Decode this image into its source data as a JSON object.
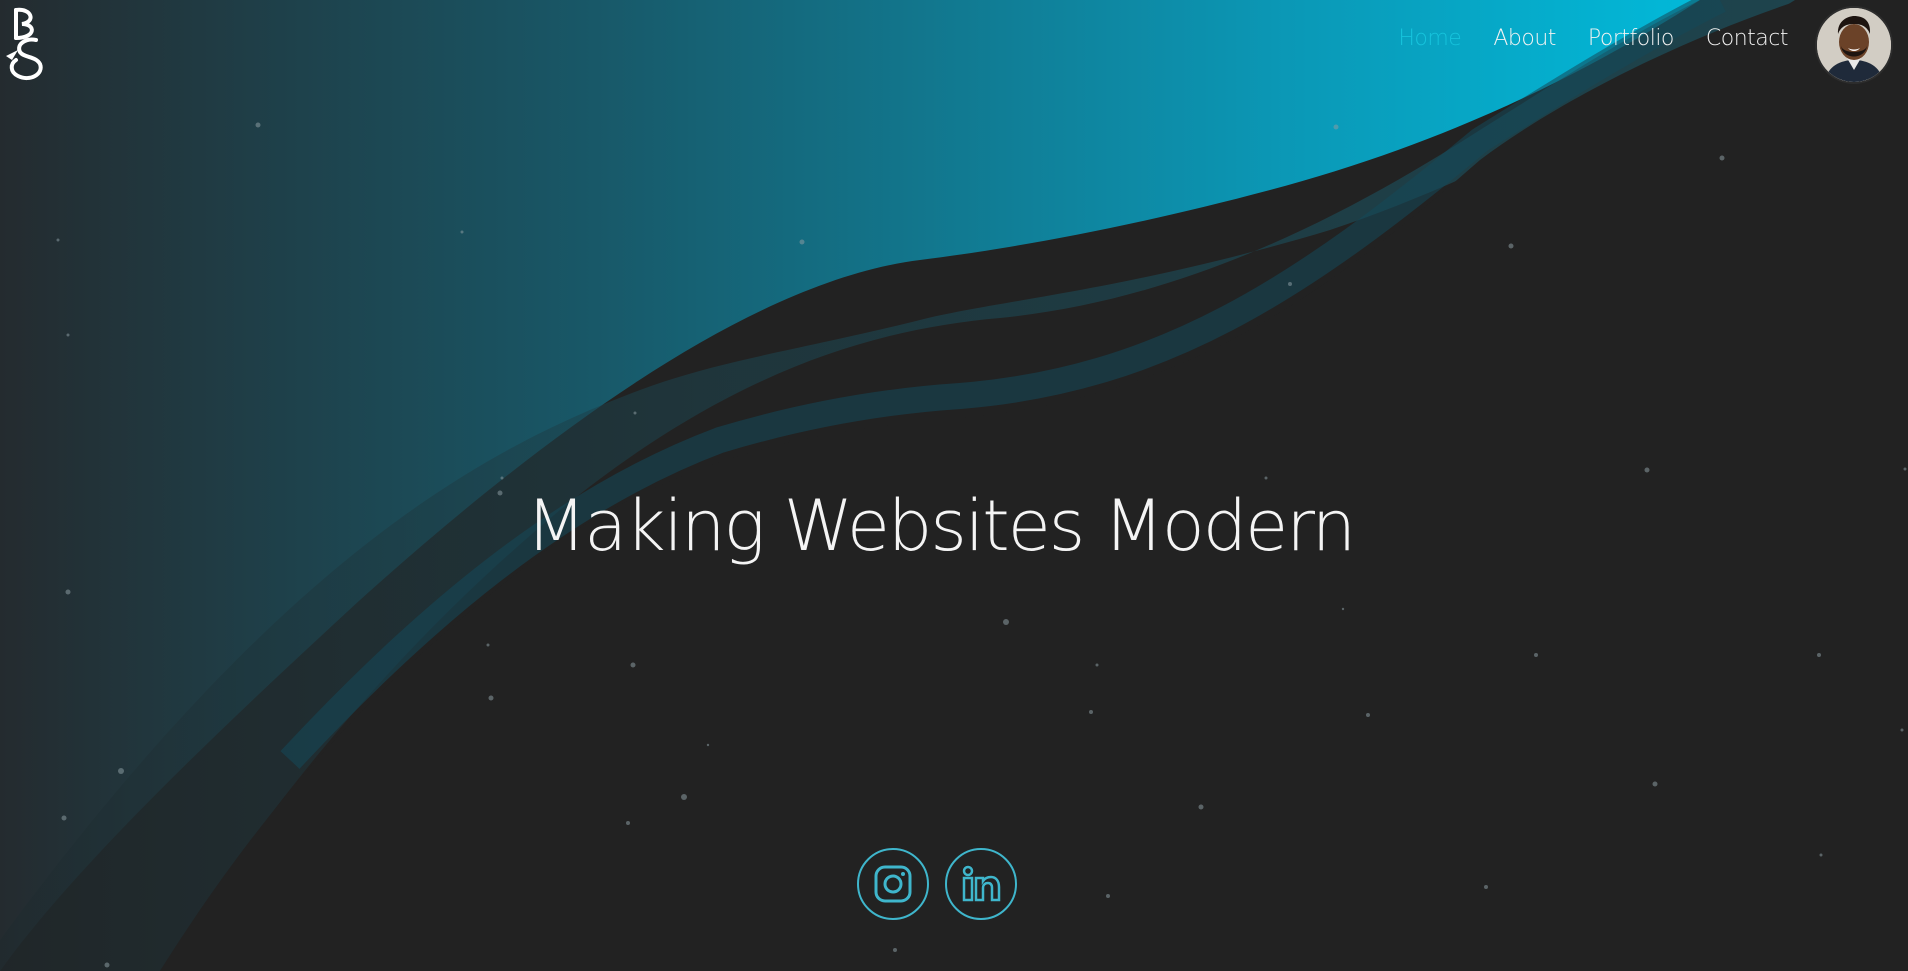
{
  "nav": {
    "items": [
      {
        "label": "Home",
        "active": true
      },
      {
        "label": "About",
        "active": false
      },
      {
        "label": "Portfolio",
        "active": false
      },
      {
        "label": "Contact",
        "active": false
      }
    ]
  },
  "hero": {
    "title": "Making Websites Modern"
  },
  "social": [
    {
      "icon": "instagram-icon"
    },
    {
      "icon": "linkedin-icon"
    }
  ],
  "colors": {
    "background": "#222222",
    "accent": "#16c3dc",
    "wave_light": "#0aa9c9",
    "wave_dark": "#1d3a44",
    "social_ring": "#3fb6cc"
  }
}
